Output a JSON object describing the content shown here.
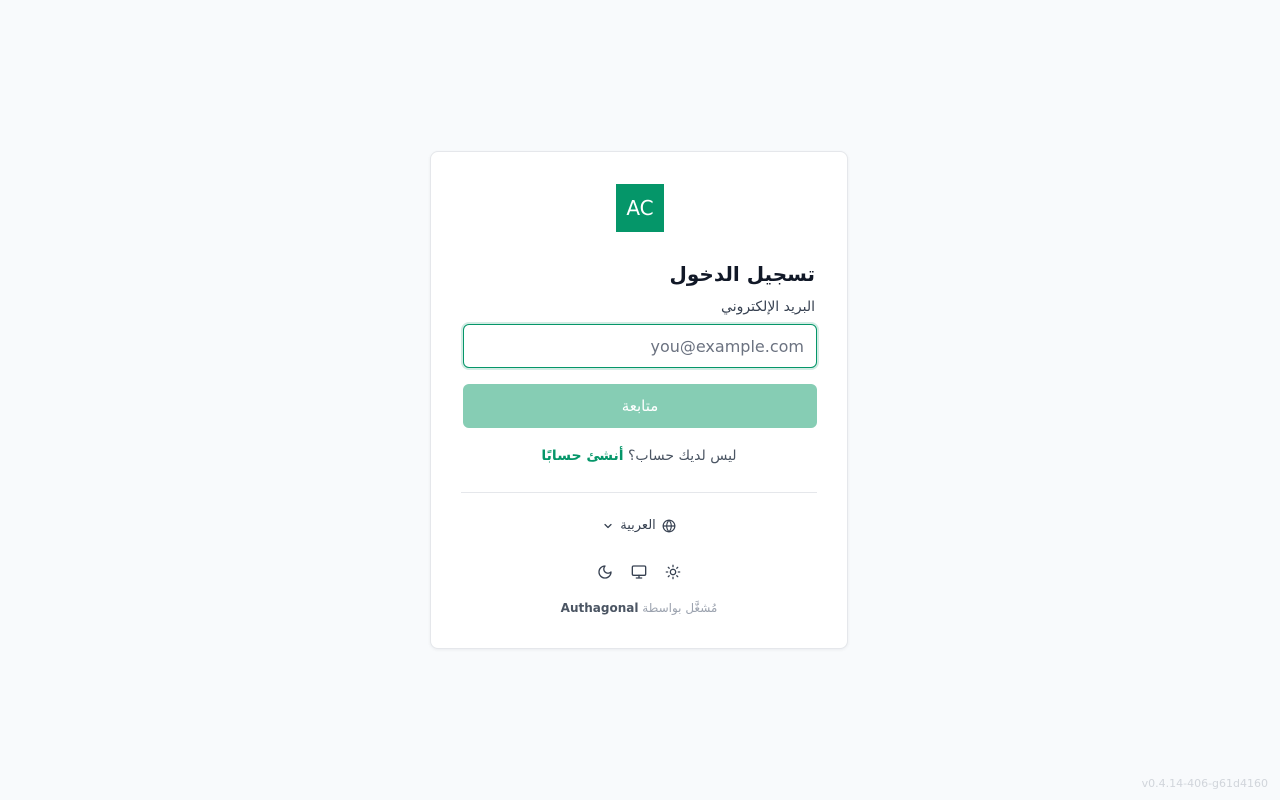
{
  "logo": {
    "text": "AC",
    "color": "#059669"
  },
  "login": {
    "title": "تسجيل الدخول",
    "email_label": "البريد الإلكتروني",
    "email_placeholder": "you@example.com",
    "email_value": "",
    "continue_label": "متابعة"
  },
  "signup": {
    "prompt": "ليس لديك حساب؟",
    "link": "أنشئ حسابًا"
  },
  "language": {
    "icon": "globe-icon",
    "selected": "العربية",
    "chevron": "chevron-down-icon"
  },
  "theme": {
    "options": [
      {
        "name": "light",
        "icon": "sun-icon"
      },
      {
        "name": "system",
        "icon": "monitor-icon"
      },
      {
        "name": "dark",
        "icon": "moon-icon"
      }
    ]
  },
  "footer": {
    "powered_prefix": "مُشغَّل بواسطة",
    "powered_brand": "Authagonal",
    "version": "v0.4.14-406-g61d4160"
  },
  "colors": {
    "accent": "#059669",
    "button_disabled": "#86cdb4",
    "background": "#f8fafc"
  }
}
